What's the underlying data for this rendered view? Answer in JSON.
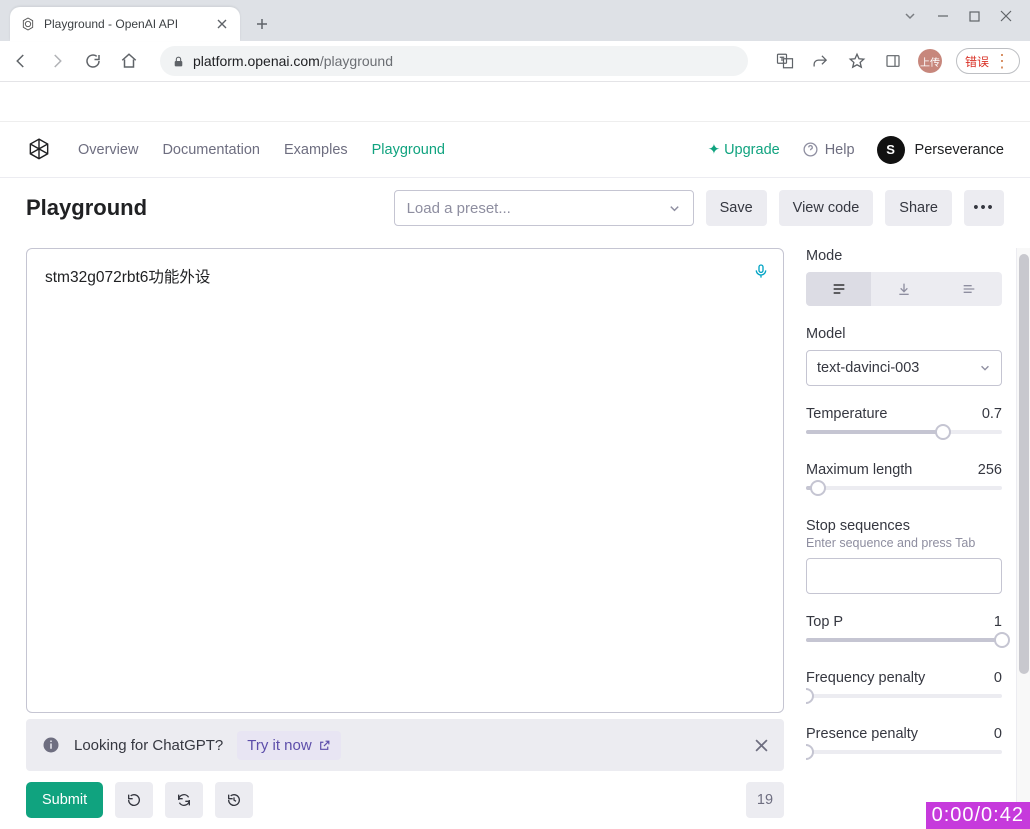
{
  "browser": {
    "tab_title": "Playground - OpenAI API",
    "url_host": "platform.openai.com",
    "url_path": "/playground",
    "avatar_text": "上传",
    "error_text": "错误"
  },
  "nav": {
    "links": {
      "overview": "Overview",
      "documentation": "Documentation",
      "examples": "Examples",
      "playground": "Playground"
    },
    "upgrade": "Upgrade",
    "help": "Help",
    "user_initial": "S",
    "user_name": "Perseverance"
  },
  "actionbar": {
    "title": "Playground",
    "preset_placeholder": "Load a preset...",
    "save": "Save",
    "view_code": "View code",
    "share": "Share"
  },
  "editor": {
    "content": "stm32g072rbt6功能外设"
  },
  "banner": {
    "text": "Looking for ChatGPT?",
    "link": "Try it now"
  },
  "footer": {
    "submit": "Submit",
    "token_count": "19"
  },
  "panel": {
    "mode_label": "Mode",
    "model_label": "Model",
    "model_value": "text-davinci-003",
    "temperature_label": "Temperature",
    "temperature_value": "0.7",
    "maxlen_label": "Maximum length",
    "maxlen_value": "256",
    "stop_label": "Stop sequences",
    "stop_hint": "Enter sequence and press Tab",
    "topp_label": "Top P",
    "topp_value": "1",
    "freq_label": "Frequency penalty",
    "freq_value": "0",
    "pres_label": "Presence penalty",
    "pres_value": "0"
  },
  "video": {
    "time": "0:00/0:42"
  }
}
